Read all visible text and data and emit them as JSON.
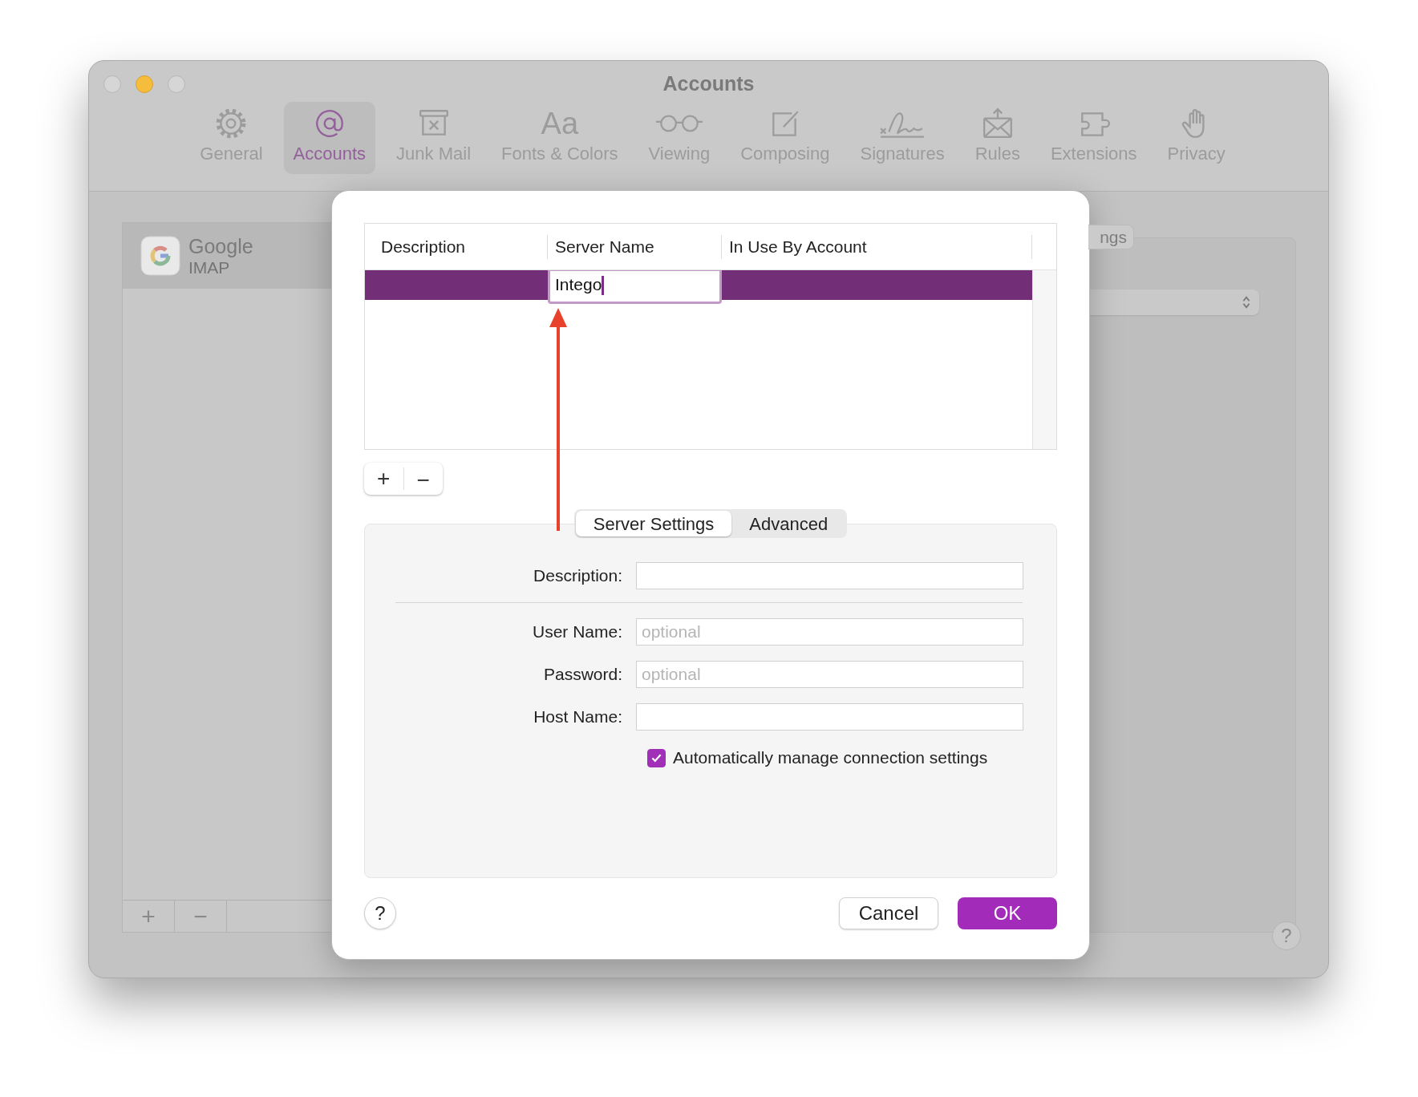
{
  "window": {
    "title": "Accounts"
  },
  "toolbar": [
    {
      "label": "General",
      "selected": false
    },
    {
      "label": "Accounts",
      "selected": true
    },
    {
      "label": "Junk Mail",
      "selected": false
    },
    {
      "label": "Fonts & Colors",
      "selected": false,
      "icon_text": "Aa"
    },
    {
      "label": "Viewing",
      "selected": false
    },
    {
      "label": "Composing",
      "selected": false
    },
    {
      "label": "Signatures",
      "selected": false
    },
    {
      "label": "Rules",
      "selected": false
    },
    {
      "label": "Extensions",
      "selected": false
    },
    {
      "label": "Privacy",
      "selected": false
    }
  ],
  "accounts": [
    {
      "name": "Google",
      "type": "IMAP",
      "selected": true
    }
  ],
  "accounts_buttons": [
    "+",
    "−"
  ],
  "right_panel": {
    "tab_fragment": "ngs",
    "help": "?"
  },
  "dialog": {
    "table": {
      "columns": [
        "Description",
        "Server Name",
        "In Use By Account"
      ],
      "rows": [
        {
          "server_name": "Intego",
          "selected": true,
          "editing": true
        }
      ]
    },
    "table_buttons": [
      "+",
      "−"
    ],
    "tabs": [
      {
        "label": "Server Settings",
        "selected": true
      },
      {
        "label": "Advanced",
        "selected": false
      }
    ],
    "fields": [
      {
        "label": "Description:"
      },
      {
        "label": "User Name:",
        "placeholder": "optional"
      },
      {
        "label": "Password:",
        "placeholder": "optional"
      },
      {
        "label": "Host Name:"
      }
    ],
    "checkbox": {
      "label": "Automatically manage connection settings",
      "checked": true
    },
    "help": "?",
    "buttons": [
      {
        "label": "Cancel",
        "kind": "secondary"
      },
      {
        "label": "OK",
        "kind": "primary"
      }
    ]
  }
}
